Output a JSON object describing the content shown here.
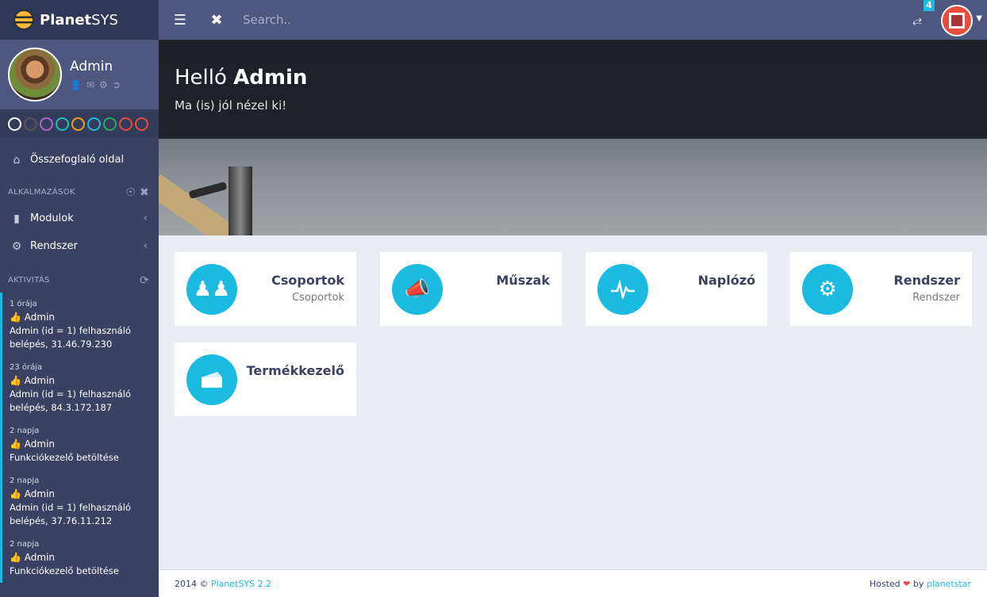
{
  "brand": {
    "name_bold": "Planet",
    "name_rest": "SYS"
  },
  "user": {
    "name": "Admin"
  },
  "themes": [
    "#ffffff",
    "#555555",
    "#af64cc",
    "#1ec1b8",
    "#f39c12",
    "#1bbae1",
    "#27ae60",
    "#e74c3c",
    "#e74c3c"
  ],
  "sidebar": {
    "summary": "Összefoglaló oldal",
    "apps_header": "ALKALMAZÁSOK",
    "items": [
      {
        "label": "Modulok"
      },
      {
        "label": "Rendszer"
      }
    ],
    "activity_header": "AKTIVITÁS",
    "activities": [
      {
        "time": "1 órája",
        "who": "Admin",
        "text": "Admin (id = 1) felhasználó belépés, 31.46.79.230"
      },
      {
        "time": "23 órája",
        "who": "Admin",
        "text": "Admin (id = 1) felhasználó belépés, 84.3.172.187"
      },
      {
        "time": "2 napja",
        "who": "Admin",
        "text": "Funkciókezelő betöltése"
      },
      {
        "time": "2 napja",
        "who": "Admin",
        "text": "Admin (id = 1) felhasználó belépés, 37.76.11.212"
      },
      {
        "time": "2 napja",
        "who": "Admin",
        "text": "Funkciókezelő betöltése"
      }
    ]
  },
  "header": {
    "search_placeholder": "Search..",
    "badge": "4"
  },
  "hero": {
    "greeting": "Helló",
    "name": "Admin",
    "subtitle": "Ma (is) jól nézel ki!"
  },
  "tiles": [
    {
      "title": "Csoportok",
      "subtitle": "Csoportok",
      "icon": "users-icon"
    },
    {
      "title": "Műszak",
      "subtitle": "",
      "icon": "megaphone-icon"
    },
    {
      "title": "Naplózó",
      "subtitle": "",
      "icon": "pulse-icon"
    },
    {
      "title": "Rendszer",
      "subtitle": "Rendszer",
      "icon": "gears-icon"
    },
    {
      "title": "Termékkezelő",
      "subtitle": "",
      "icon": "cheese-icon"
    }
  ],
  "footer": {
    "year": "2014 © ",
    "product": "PlanetSYS 2.2",
    "hosted": "Hosted ",
    "by": " by ",
    "host": "planetstar"
  }
}
